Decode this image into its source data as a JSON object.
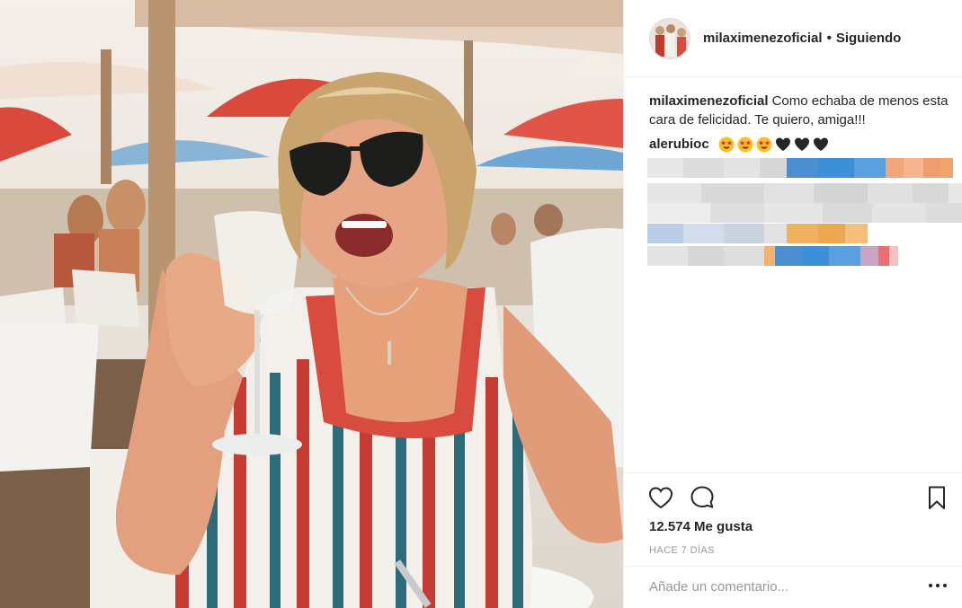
{
  "post": {
    "username": "milaximenezoficial",
    "separator": "•",
    "follow_state": "Siguiendo",
    "caption_user": "milaximenezoficial",
    "caption_text": "Como echaba de menos esta cara de felicidad. Te quiero, amiga!!!",
    "comments": [
      {
        "user": "alerubioc",
        "emojis": [
          "star-struck-emoji",
          "star-struck-emoji",
          "star-struck-emoji",
          "black-heart-emoji",
          "black-heart-emoji",
          "black-heart-emoji"
        ]
      }
    ],
    "likes_text": "12.574 Me gusta",
    "timestamp": "HACE 7 DÍAS",
    "comment_placeholder": "Añade un comentario..."
  },
  "icons": {
    "like": "heart-icon",
    "comment": "comment-bubble-icon",
    "save": "bookmark-icon",
    "more": "more-options-icon"
  },
  "colors": {
    "text": "#262626",
    "muted": "#999999",
    "divider": "#efefef",
    "pixelated_blue": "#3d8fd8",
    "pixelated_orange": "#f0a46a"
  }
}
